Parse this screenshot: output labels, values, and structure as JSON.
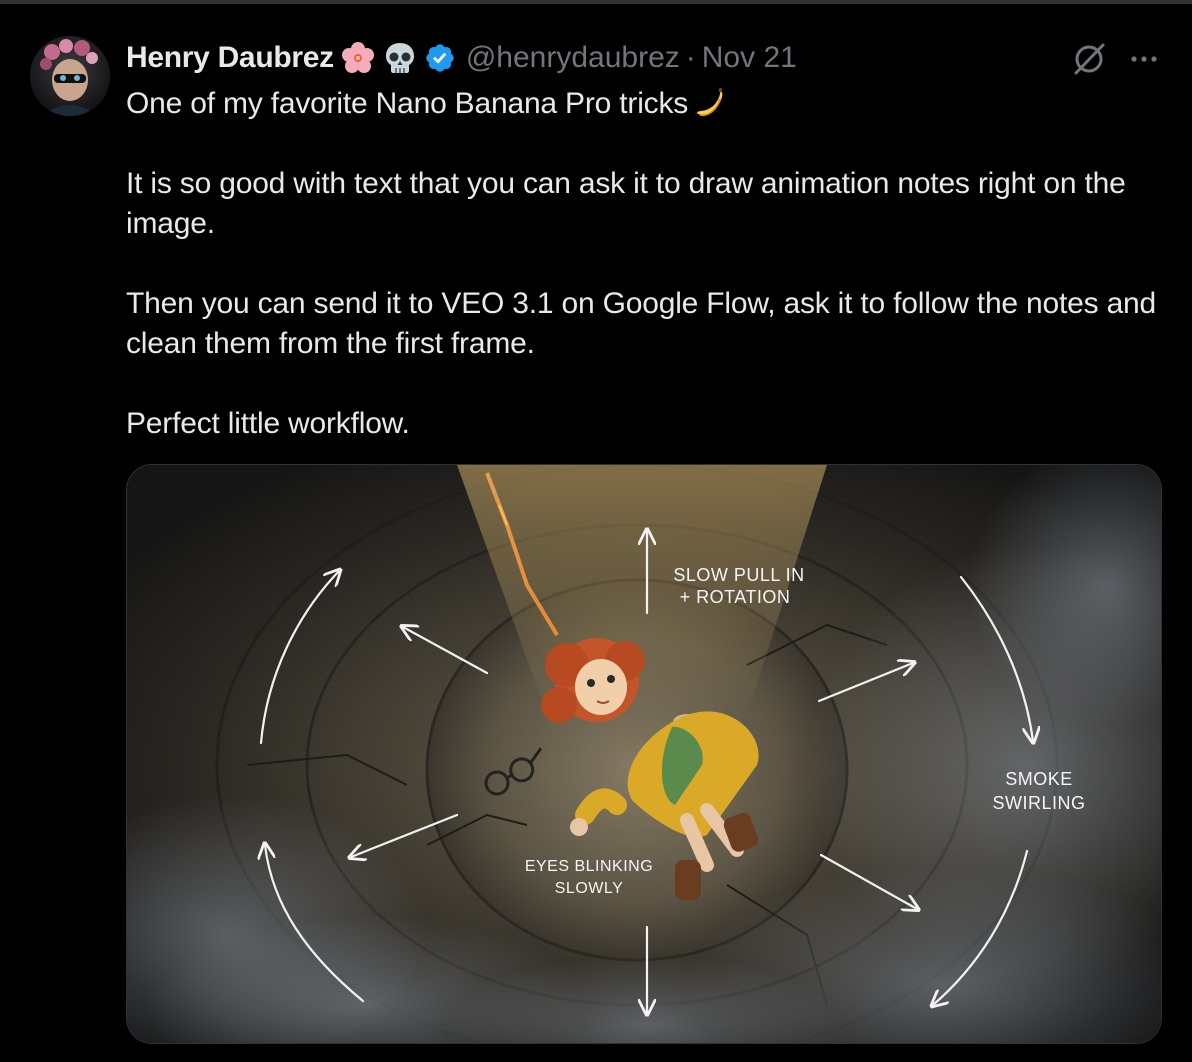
{
  "author": {
    "name": "Henry Daubrez",
    "emojis": [
      "cherry-blossom-icon",
      "skull-icon"
    ],
    "verified": true,
    "handle": "@henrydaubrez",
    "separator": "·",
    "date": "Nov 21"
  },
  "tweet": {
    "line1": "One of my favorite Nano Banana Pro tricks",
    "line1_emoji": "banana-icon",
    "para2": "It is so good with text that you can ask it to draw animation notes right on the image.",
    "para3": "Then you can send it to VEO 3.1 on Google Flow, ask it to follow the notes and clean them from the first frame.",
    "para4": "Perfect little workflow."
  },
  "media": {
    "annotations": {
      "top_line1": "SLOW PULL IN",
      "top_line2": "+ ROTATION",
      "right_line1": "SMOKE",
      "right_line2": "SWIRLING",
      "bottom_line1": "EYES BLINKING",
      "bottom_line2": "SLOWLY"
    }
  },
  "colors": {
    "background": "#000000",
    "text": "#e7e9ea",
    "muted": "#71767b",
    "verified": "#1d9bf0",
    "border": "#2f3336"
  }
}
